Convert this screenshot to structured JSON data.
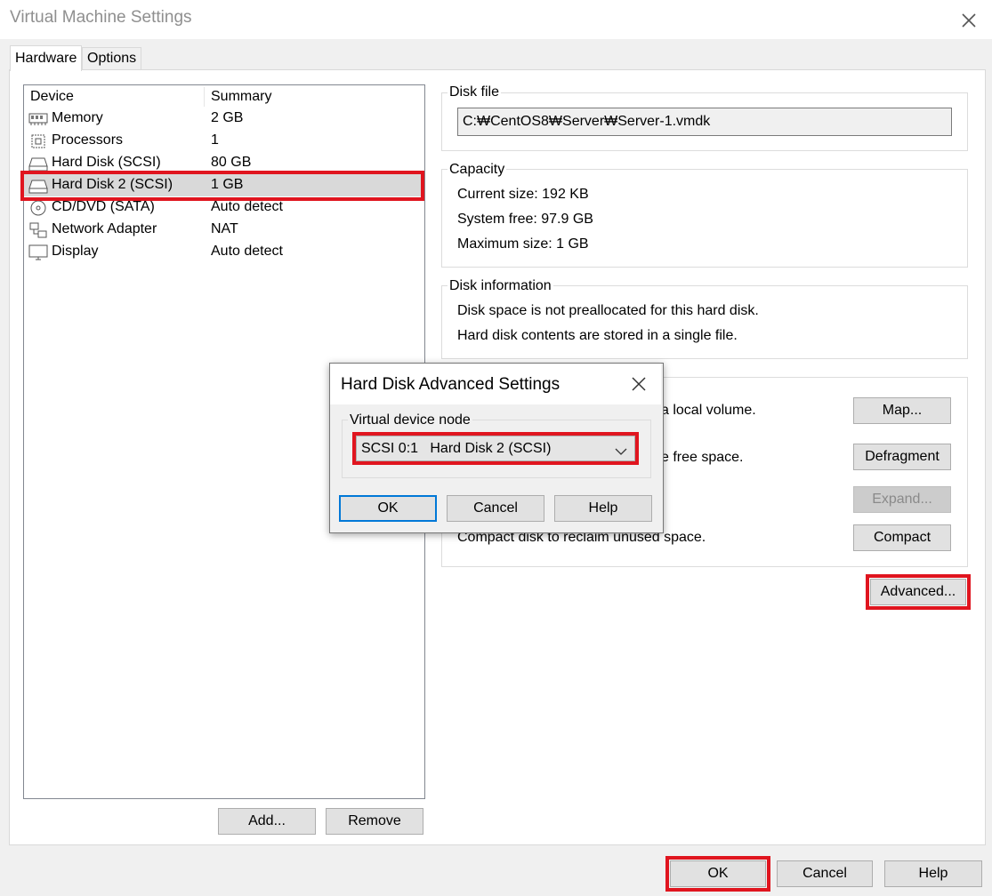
{
  "window": {
    "title": "Virtual Machine Settings"
  },
  "tabs": [
    {
      "label": "Hardware"
    },
    {
      "label": "Options"
    }
  ],
  "device_list": {
    "columns": [
      "Device",
      "Summary"
    ],
    "rows": [
      {
        "icon": "memory-icon",
        "name": "Memory",
        "summary": "2 GB"
      },
      {
        "icon": "processor-icon",
        "name": "Processors",
        "summary": "1"
      },
      {
        "icon": "hard-disk-icon",
        "name": "Hard Disk (SCSI)",
        "summary": "80 GB"
      },
      {
        "icon": "hard-disk-icon",
        "name": "Hard Disk 2 (SCSI)",
        "summary": "1 GB",
        "selected": true
      },
      {
        "icon": "cd-dvd-icon",
        "name": "CD/DVD (SATA)",
        "summary": "Auto detect"
      },
      {
        "icon": "network-adapter-icon",
        "name": "Network Adapter",
        "summary": "NAT"
      },
      {
        "icon": "display-icon",
        "name": "Display",
        "summary": "Auto detect"
      }
    ],
    "add_label": "Add...",
    "remove_label": "Remove"
  },
  "disk_file": {
    "legend": "Disk file",
    "value": "C:₩CentOS8₩Server₩Server-1.vmdk"
  },
  "capacity": {
    "legend": "Capacity",
    "current": "Current size:  192 KB",
    "free": "System free:  97.9 GB",
    "maximum": "Maximum size:  1 GB"
  },
  "disk_info": {
    "legend": "Disk information",
    "line1": "Disk space is not preallocated for this hard disk.",
    "line2": "Hard disk contents are stored in a single file."
  },
  "utilities": {
    "map_text": "a local volume.",
    "defrag_text": "e free space.",
    "compact_text": "Compact disk to reclaim unused space.",
    "map_label": "Map...",
    "defrag_label": "Defragment",
    "expand_label": "Expand...",
    "compact_label": "Compact"
  },
  "advanced_label": "Advanced...",
  "footer": {
    "ok": "OK",
    "cancel": "Cancel",
    "help": "Help"
  },
  "dialog": {
    "title": "Hard Disk Advanced Settings",
    "group_label": "Virtual device node",
    "select_value": "SCSI 0:1   Hard Disk 2 (SCSI)",
    "ok": "OK",
    "cancel": "Cancel",
    "help": "Help"
  },
  "colors": {
    "highlight": "#e0151f",
    "selection": "#d9d9d9",
    "focus": "#0078d7"
  }
}
